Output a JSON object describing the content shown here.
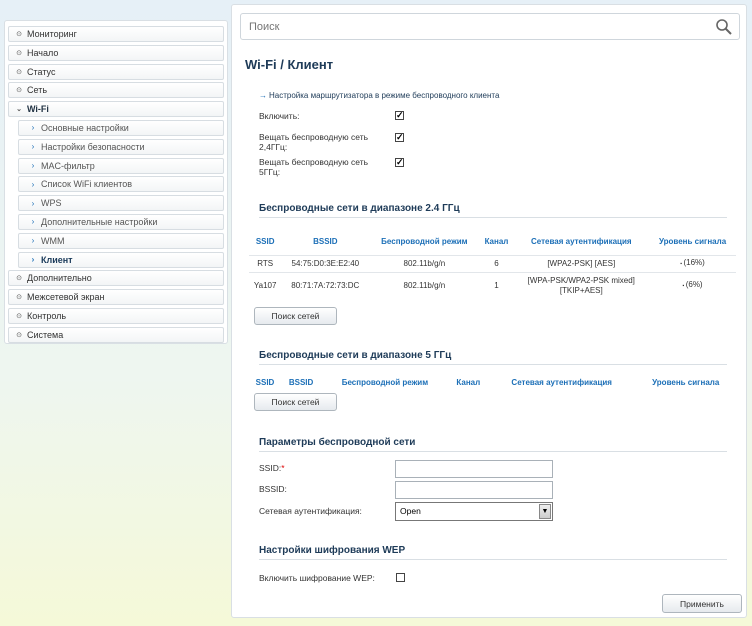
{
  "sidebar": {
    "items": [
      {
        "label": "Мониторинг",
        "icon": "chevron-right-icon"
      },
      {
        "label": "Начало",
        "icon": "chevron-right-icon"
      },
      {
        "label": "Статус",
        "icon": "chevron-right-icon"
      },
      {
        "label": "Сеть",
        "icon": "chevron-right-icon"
      },
      {
        "label": "Wi-Fi",
        "icon": "chevron-down-icon",
        "open": true
      },
      {
        "label": "Основные настройки",
        "sub": true
      },
      {
        "label": "Настройки безопасности",
        "sub": true
      },
      {
        "label": "MAC-фильтр",
        "sub": true
      },
      {
        "label": "Список WiFi клиентов",
        "sub": true
      },
      {
        "label": "WPS",
        "sub": true
      },
      {
        "label": "Дополнительные настройки",
        "sub": true
      },
      {
        "label": "WMM",
        "sub": true
      },
      {
        "label": "Клиент",
        "sub": true,
        "active": true
      },
      {
        "label": "Дополнительно",
        "icon": "chevron-right-icon"
      },
      {
        "label": "Межсетевой экран",
        "icon": "chevron-right-icon"
      },
      {
        "label": "Контроль",
        "icon": "chevron-right-icon"
      },
      {
        "label": "Система",
        "icon": "chevron-right-icon"
      }
    ]
  },
  "search": {
    "placeholder": "Поиск",
    "icon": "search-icon"
  },
  "page": {
    "title": "Wi-Fi /  Клиент",
    "subtitle": "Настройка маршрутизатора в режиме беспроводного клиента"
  },
  "form": {
    "enable_label": "Включить:",
    "enable_checked": true,
    "broadcast24_label_1": "Вещать беспроводную сеть",
    "broadcast24_label_2": "2,4ГГц:",
    "broadcast24_checked": true,
    "broadcast5_label_1": "Вещать беспроводную сеть",
    "broadcast5_label_2": "5ГГц:",
    "broadcast5_checked": true
  },
  "net24": {
    "heading": "Беспроводные сети в диапазоне 2.4 ГГц",
    "columns": [
      "SSID",
      "BSSID",
      "Беспроводной режим",
      "Канал",
      "Сетевая аутентификация",
      "Уровень сигнала"
    ],
    "rows": [
      {
        "ssid": "RTS",
        "bssid": "54:75:D0:3E:E2:40",
        "mode": "802.11b/g/n",
        "channel": "6",
        "auth_1": "[WPA2-PSK] [AES]",
        "auth_2": "",
        "signal": "(16%)"
      },
      {
        "ssid": "Ya107",
        "bssid": "80:71:7A:72:73:DC",
        "mode": "802.11b/g/n",
        "channel": "1",
        "auth_1": "[WPA-PSK/WPA2-PSK mixed]",
        "auth_2": "[TKIP+AES]",
        "signal": "(6%)"
      }
    ],
    "scan_button": "Поиск сетей"
  },
  "net5": {
    "heading": "Беспроводные сети в диапазоне 5 ГГц",
    "columns": [
      "SSID",
      "BSSID",
      "Беспроводной режим",
      "Канал",
      "Сетевая аутентификация",
      "Уровень сигнала"
    ],
    "scan_button": "Поиск сетей"
  },
  "params": {
    "heading": "Параметры беспроводной сети",
    "ssid_label": "SSID:",
    "ssid_required": "*",
    "ssid_value": "",
    "bssid_label": "BSSID:",
    "bssid_value": "",
    "auth_label": "Сетевая аутентификация:",
    "auth_value": "Open"
  },
  "wep": {
    "heading": "Настройки шифрования WEP",
    "enable_label": "Включить шифрование WEP:",
    "enable_checked": false
  },
  "apply_button": "Применить"
}
